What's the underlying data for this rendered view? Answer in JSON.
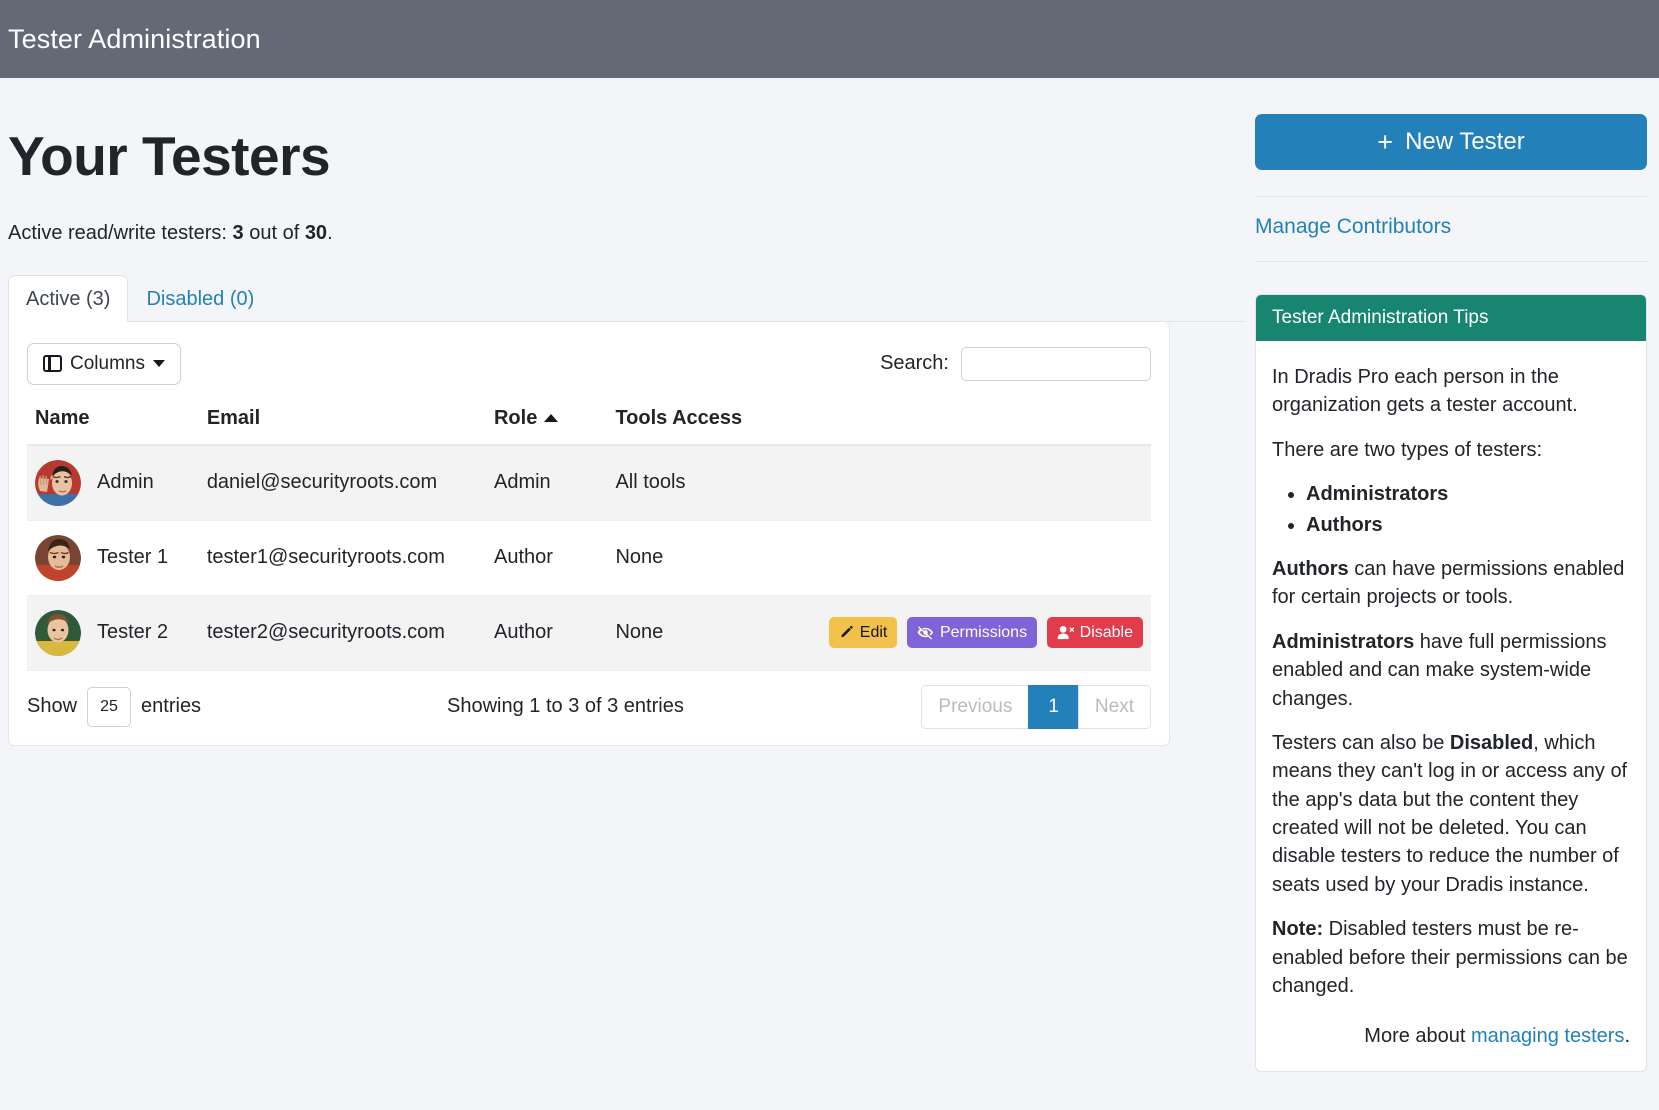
{
  "topbar": {
    "title": "Tester Administration"
  },
  "header": {
    "page_title": "Your Testers",
    "subtitle_prefix": "Active read/write testers: ",
    "subtitle_count": "3",
    "subtitle_middle": " out of ",
    "subtitle_total": "30",
    "subtitle_suffix": "."
  },
  "tabs": [
    {
      "label": "Active (3)",
      "active": true
    },
    {
      "label": "Disabled (0)",
      "active": false
    }
  ],
  "controls": {
    "columns_label": "Columns",
    "search_label": "Search:",
    "search_value": "",
    "search_placeholder": ""
  },
  "table": {
    "columns": [
      "Name",
      "Email",
      "Role",
      "Tools Access",
      ""
    ],
    "sorted_column": "Role",
    "sort_direction": "asc",
    "rows": [
      {
        "name": "Admin",
        "email": "daniel@securityroots.com",
        "role": "Admin",
        "tools": "All tools",
        "avatar": "spock-avatar"
      },
      {
        "name": "Tester 1",
        "email": "tester1@securityroots.com",
        "role": "Author",
        "tools": "None",
        "avatar": "scotty-avatar"
      },
      {
        "name": "Tester 2",
        "email": "tester2@securityroots.com",
        "role": "Author",
        "tools": "None",
        "avatar": "kirk-avatar"
      }
    ],
    "row_actions": {
      "edit_label": "Edit",
      "permissions_label": "Permissions",
      "disable_label": "Disable"
    }
  },
  "footer": {
    "show_label": "Show",
    "entries_value": "25",
    "entries_label": "entries",
    "showing_info": "Showing 1 to 3 of 3 entries",
    "pagination": [
      "Previous",
      "1",
      "Next"
    ],
    "current_page": "1"
  },
  "sidebar": {
    "new_tester_label": "New Tester",
    "plus_glyph": "+",
    "manage_contributors_label": "Manage Contributors",
    "tips": {
      "heading": "Tester Administration Tips",
      "p1": "In Dradis Pro each person in the organization gets a tester account.",
      "p2": "There are two types of testers:",
      "types": [
        "Administrators",
        "Authors"
      ],
      "p3_bold": "Authors",
      "p3_rest": " can have permissions enabled for certain projects or tools.",
      "p4_bold": "Administrators",
      "p4_rest": " have full permissions enabled and can make system-wide changes.",
      "p5_a": "Testers can also be ",
      "p5_bold": "Disabled",
      "p5_b": ", which means they can't log in or access any of the app's data but the content they created will not be deleted. You can disable testers to reduce the number of seats used by your Dradis instance.",
      "p6_bold": "Note:",
      "p6_rest": " Disabled testers must be re-enabled before their permissions can be changed.",
      "more_prefix": "More about ",
      "more_link": "managing testers",
      "more_suffix": "."
    }
  },
  "colors": {
    "topbar": "#636a76",
    "primary": "#2380b8",
    "tips_header": "#17856f",
    "edit": "#f2c14a",
    "permissions": "#8163d8",
    "disable": "#e03c4c"
  }
}
